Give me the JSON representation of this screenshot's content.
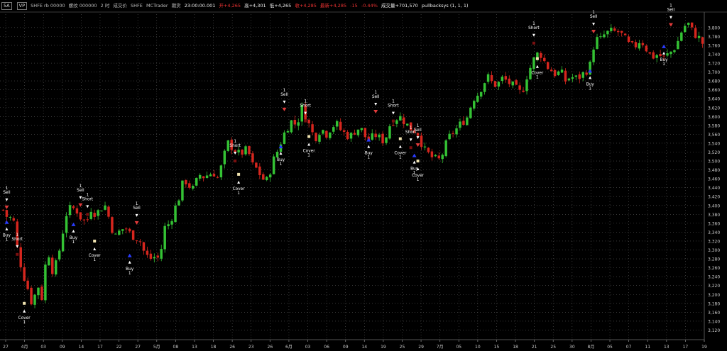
{
  "header": {
    "timeframe_btn": "5A",
    "mode_btn": "VP",
    "symbol": "SHFE rb 00000",
    "contract": "螺纹 000000",
    "interval": "2 时",
    "field": "成交价",
    "exchange": "SHFE",
    "source": "MCTrader",
    "period_label": "期货",
    "time": "23:00:00.001",
    "open": "开+4,265",
    "high": "高+4,301",
    "low": "低+4,265",
    "bid": "收+4,285",
    "last": "最新+4,285",
    "change": "-15",
    "change_pct": "-0.44%",
    "volume": "成交量+701,570",
    "strategy": "pullbacksys (1, 1, 1)"
  },
  "colors": {
    "background": "#000000",
    "up_bar": "#34c234",
    "down_bar": "#d6261e",
    "grid": "#5a5a5a",
    "axis_text": "#c8c8c8",
    "signal_text": "#ffffff",
    "buy_arrow": "#2a3cff",
    "sell_arrow": "#e23b3b",
    "signal_marker": "#f0e3b0",
    "dark_marker": "#7a1010"
  },
  "chart_data": {
    "type": "candlestick",
    "ylim": [
      3100,
      3830
    ],
    "y_ticks": [
      3120,
      3140,
      3160,
      3180,
      3200,
      3220,
      3240,
      3260,
      3280,
      3300,
      3320,
      3340,
      3360,
      3380,
      3400,
      3420,
      3440,
      3460,
      3480,
      3500,
      3520,
      3540,
      3560,
      3580,
      3600,
      3620,
      3640,
      3660,
      3680,
      3700,
      3720,
      3740,
      3760,
      3780,
      3800
    ],
    "y_tick_labels": [
      "3,120",
      "3,140",
      "3,160",
      "3,180",
      "3,200",
      "3,220",
      "3,240",
      "3,260",
      "3,280",
      "3,300",
      "3,320",
      "3,340",
      "3,360",
      "3,380",
      "3,400",
      "3,420",
      "3,440",
      "3,460",
      "3,480",
      "3,500",
      "3,520",
      "3,540",
      "3,560",
      "3,580",
      "3,600",
      "3,620",
      "3,640",
      "3,660",
      "3,680",
      "3,700",
      "3,720",
      "3,740",
      "3,760",
      "3,780",
      "3,800"
    ],
    "x_labels": [
      "27",
      "4月",
      "03",
      "09",
      "14",
      "17",
      "22",
      "27",
      "5月",
      "08",
      "13",
      "18",
      "26",
      "23",
      "26",
      "6月",
      "03",
      "06",
      "09",
      "14",
      "19",
      "25",
      "29",
      "7月",
      "05",
      "10",
      "15",
      "18",
      "21",
      "25",
      "30",
      "8月",
      "05",
      "07",
      "11",
      "13",
      "17",
      "19"
    ],
    "closes": [
      3390,
      3370,
      3375,
      3295,
      3250,
      3215,
      3175,
      3225,
      3190,
      3310,
      3255,
      3270,
      3330,
      3385,
      3395,
      3390,
      3370,
      3360,
      3395,
      3380,
      3395,
      3400,
      3355,
      3330,
      3345,
      3350,
      3335,
      3330,
      3320,
      3290,
      3280,
      3285,
      3280,
      3350,
      3360,
      3390,
      3420,
      3460,
      3445,
      3435,
      3470,
      3465,
      3470,
      3475,
      3460,
      3505,
      3540,
      3530,
      3515,
      3520,
      3525,
      3490,
      3480,
      3460,
      3455,
      3495,
      3520,
      3550,
      3575,
      3590,
      3580,
      3620,
      3600,
      3565,
      3555,
      3575,
      3560,
      3575,
      3585,
      3570,
      3560,
      3555,
      3570,
      3575,
      3555,
      3545,
      3560,
      3550,
      3545,
      3580,
      3595,
      3600,
      3590,
      3575,
      3570,
      3560,
      3525,
      3515,
      3505,
      3500,
      3520,
      3550,
      3565,
      3575,
      3590,
      3600,
      3640,
      3650,
      3670,
      3690,
      3675,
      3670,
      3685,
      3680,
      3670,
      3660,
      3650,
      3690,
      3715,
      3740,
      3740,
      3715,
      3705,
      3695,
      3700,
      3680,
      3690,
      3685,
      3690,
      3700,
      3715,
      3775,
      3770,
      3785,
      3790,
      3790,
      3790,
      3775,
      3760,
      3755,
      3770,
      3765,
      3740,
      3735,
      3740,
      3730,
      3740,
      3750,
      3770,
      3800,
      3810,
      3790,
      3780,
      3765
    ],
    "series": [
      {
        "name": "Buy"
      },
      {
        "name": "Sell"
      },
      {
        "name": "Short"
      },
      {
        "name": "Cover"
      }
    ],
    "signals": [
      {
        "type": "Sell",
        "qty": "1",
        "bar": 1,
        "price": 3395
      },
      {
        "type": "Buy",
        "qty": "1",
        "bar": 1,
        "price": 3365
      },
      {
        "type": "Short",
        "qty": "1",
        "bar": 4,
        "price": 3290
      },
      {
        "type": "Cover",
        "qty": "1",
        "bar": 6,
        "price": 3180
      },
      {
        "type": "Sell",
        "qty": "1",
        "bar": 22,
        "price": 3400
      },
      {
        "type": "Short",
        "qty": "1",
        "bar": 24,
        "price": 3380
      },
      {
        "type": "Buy",
        "qty": "1",
        "bar": 20,
        "price": 3360
      },
      {
        "type": "Cover",
        "qty": "1",
        "bar": 26,
        "price": 3320
      },
      {
        "type": "Buy",
        "qty": "1",
        "bar": 36,
        "price": 3290
      },
      {
        "type": "Sell",
        "qty": "1",
        "bar": 38,
        "price": 3360
      },
      {
        "type": "Short",
        "qty": "1",
        "bar": 66,
        "price": 3500
      },
      {
        "type": "Cover",
        "qty": "1",
        "bar": 67,
        "price": 3470
      },
      {
        "type": "Buy",
        "qty": "1",
        "bar": 79,
        "price": 3535
      },
      {
        "type": "Sell",
        "qty": "1",
        "bar": 80,
        "price": 3615
      },
      {
        "type": "Short",
        "qty": "1",
        "bar": 86,
        "price": 3590
      },
      {
        "type": "Cover",
        "qty": "1",
        "bar": 87,
        "price": 3555
      },
      {
        "type": "Buy",
        "qty": "1",
        "bar": 104,
        "price": 3550
      },
      {
        "type": "Sell",
        "qty": "1",
        "bar": 106,
        "price": 3610
      },
      {
        "type": "Short",
        "qty": "1",
        "bar": 111,
        "price": 3590
      },
      {
        "type": "Cover",
        "qty": "1",
        "bar": 113,
        "price": 3550
      },
      {
        "type": "Short",
        "qty": "1",
        "bar": 116,
        "price": 3530
      },
      {
        "type": "Sell",
        "qty": "1",
        "bar": 118,
        "price": 3535
      },
      {
        "type": "Buy",
        "qty": "1",
        "bar": 117,
        "price": 3515
      },
      {
        "type": "Cover",
        "qty": "1",
        "bar": 118,
        "price": 3500
      },
      {
        "type": "Short",
        "qty": "1",
        "bar": 151,
        "price": 3765
      },
      {
        "type": "Cover",
        "qty": "1",
        "bar": 152,
        "price": 3730
      },
      {
        "type": "Buy",
        "qty": "1",
        "bar": 167,
        "price": 3705
      },
      {
        "type": "Sell",
        "qty": "1",
        "bar": 168,
        "price": 3790
      },
      {
        "type": "Buy",
        "qty": "1",
        "bar": 188,
        "price": 3760
      },
      {
        "type": "Sell",
        "qty": "1",
        "bar": 190,
        "price": 3805
      }
    ]
  }
}
